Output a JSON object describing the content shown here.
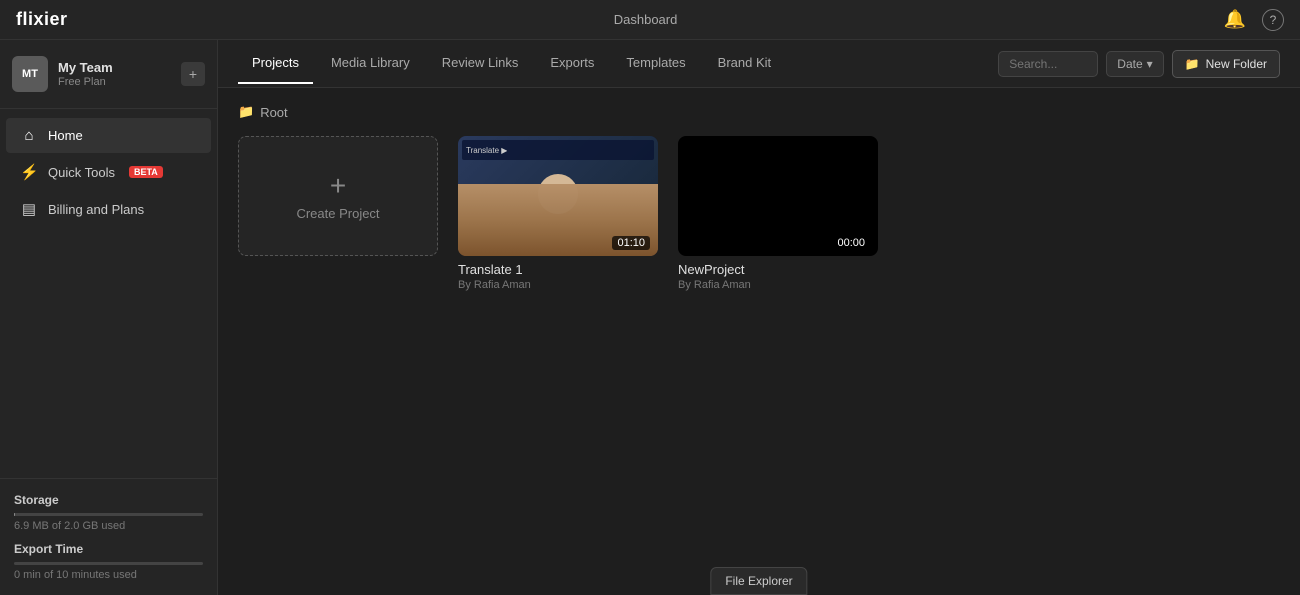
{
  "app": {
    "logo": "flixier",
    "title": "Dashboard"
  },
  "topbar": {
    "logo": "flixier",
    "title": "Dashboard",
    "notification_icon": "🔔",
    "help_icon": "?"
  },
  "sidebar": {
    "team": {
      "initials": "MT",
      "name": "My Team",
      "plan": "Free Plan",
      "settings_icon": "+"
    },
    "nav": [
      {
        "id": "home",
        "label": "Home",
        "icon": "⌂",
        "active": true
      },
      {
        "id": "quick-tools",
        "label": "Quick Tools",
        "badge": "beta",
        "icon": "⚡",
        "active": false
      },
      {
        "id": "billing",
        "label": "Billing and Plans",
        "icon": "▤",
        "active": false
      }
    ],
    "storage": {
      "label": "Storage",
      "used_text": "6.9 MB of 2.0 GB used",
      "percent": 0.3
    },
    "export_time": {
      "label": "Export Time",
      "used_text": "0 min of 10 minutes used",
      "percent": 0
    }
  },
  "tabs": [
    {
      "id": "projects",
      "label": "Projects",
      "active": true
    },
    {
      "id": "media-library",
      "label": "Media Library",
      "active": false
    },
    {
      "id": "review-links",
      "label": "Review Links",
      "active": false
    },
    {
      "id": "exports",
      "label": "Exports",
      "active": false
    },
    {
      "id": "templates",
      "label": "Templates",
      "active": false
    },
    {
      "id": "brand-kit",
      "label": "Brand Kit",
      "active": false
    }
  ],
  "toolbar": {
    "search_placeholder": "Search...",
    "date_label": "Date",
    "new_folder_label": "New Folder",
    "folder_icon": "📁"
  },
  "breadcrumb": {
    "icon": "📁",
    "label": "Root"
  },
  "projects": [
    {
      "id": "create",
      "type": "create",
      "label": "Create Project"
    },
    {
      "id": "translate1",
      "type": "video",
      "title": "Translate 1",
      "author": "By Rafia Aman",
      "duration": "01:10",
      "has_thumbnail": true
    },
    {
      "id": "newproject",
      "type": "video",
      "title": "NewProject",
      "author": "By Rafia Aman",
      "duration": "00:00",
      "has_thumbnail": false
    }
  ],
  "file_explorer": {
    "label": "File Explorer"
  }
}
